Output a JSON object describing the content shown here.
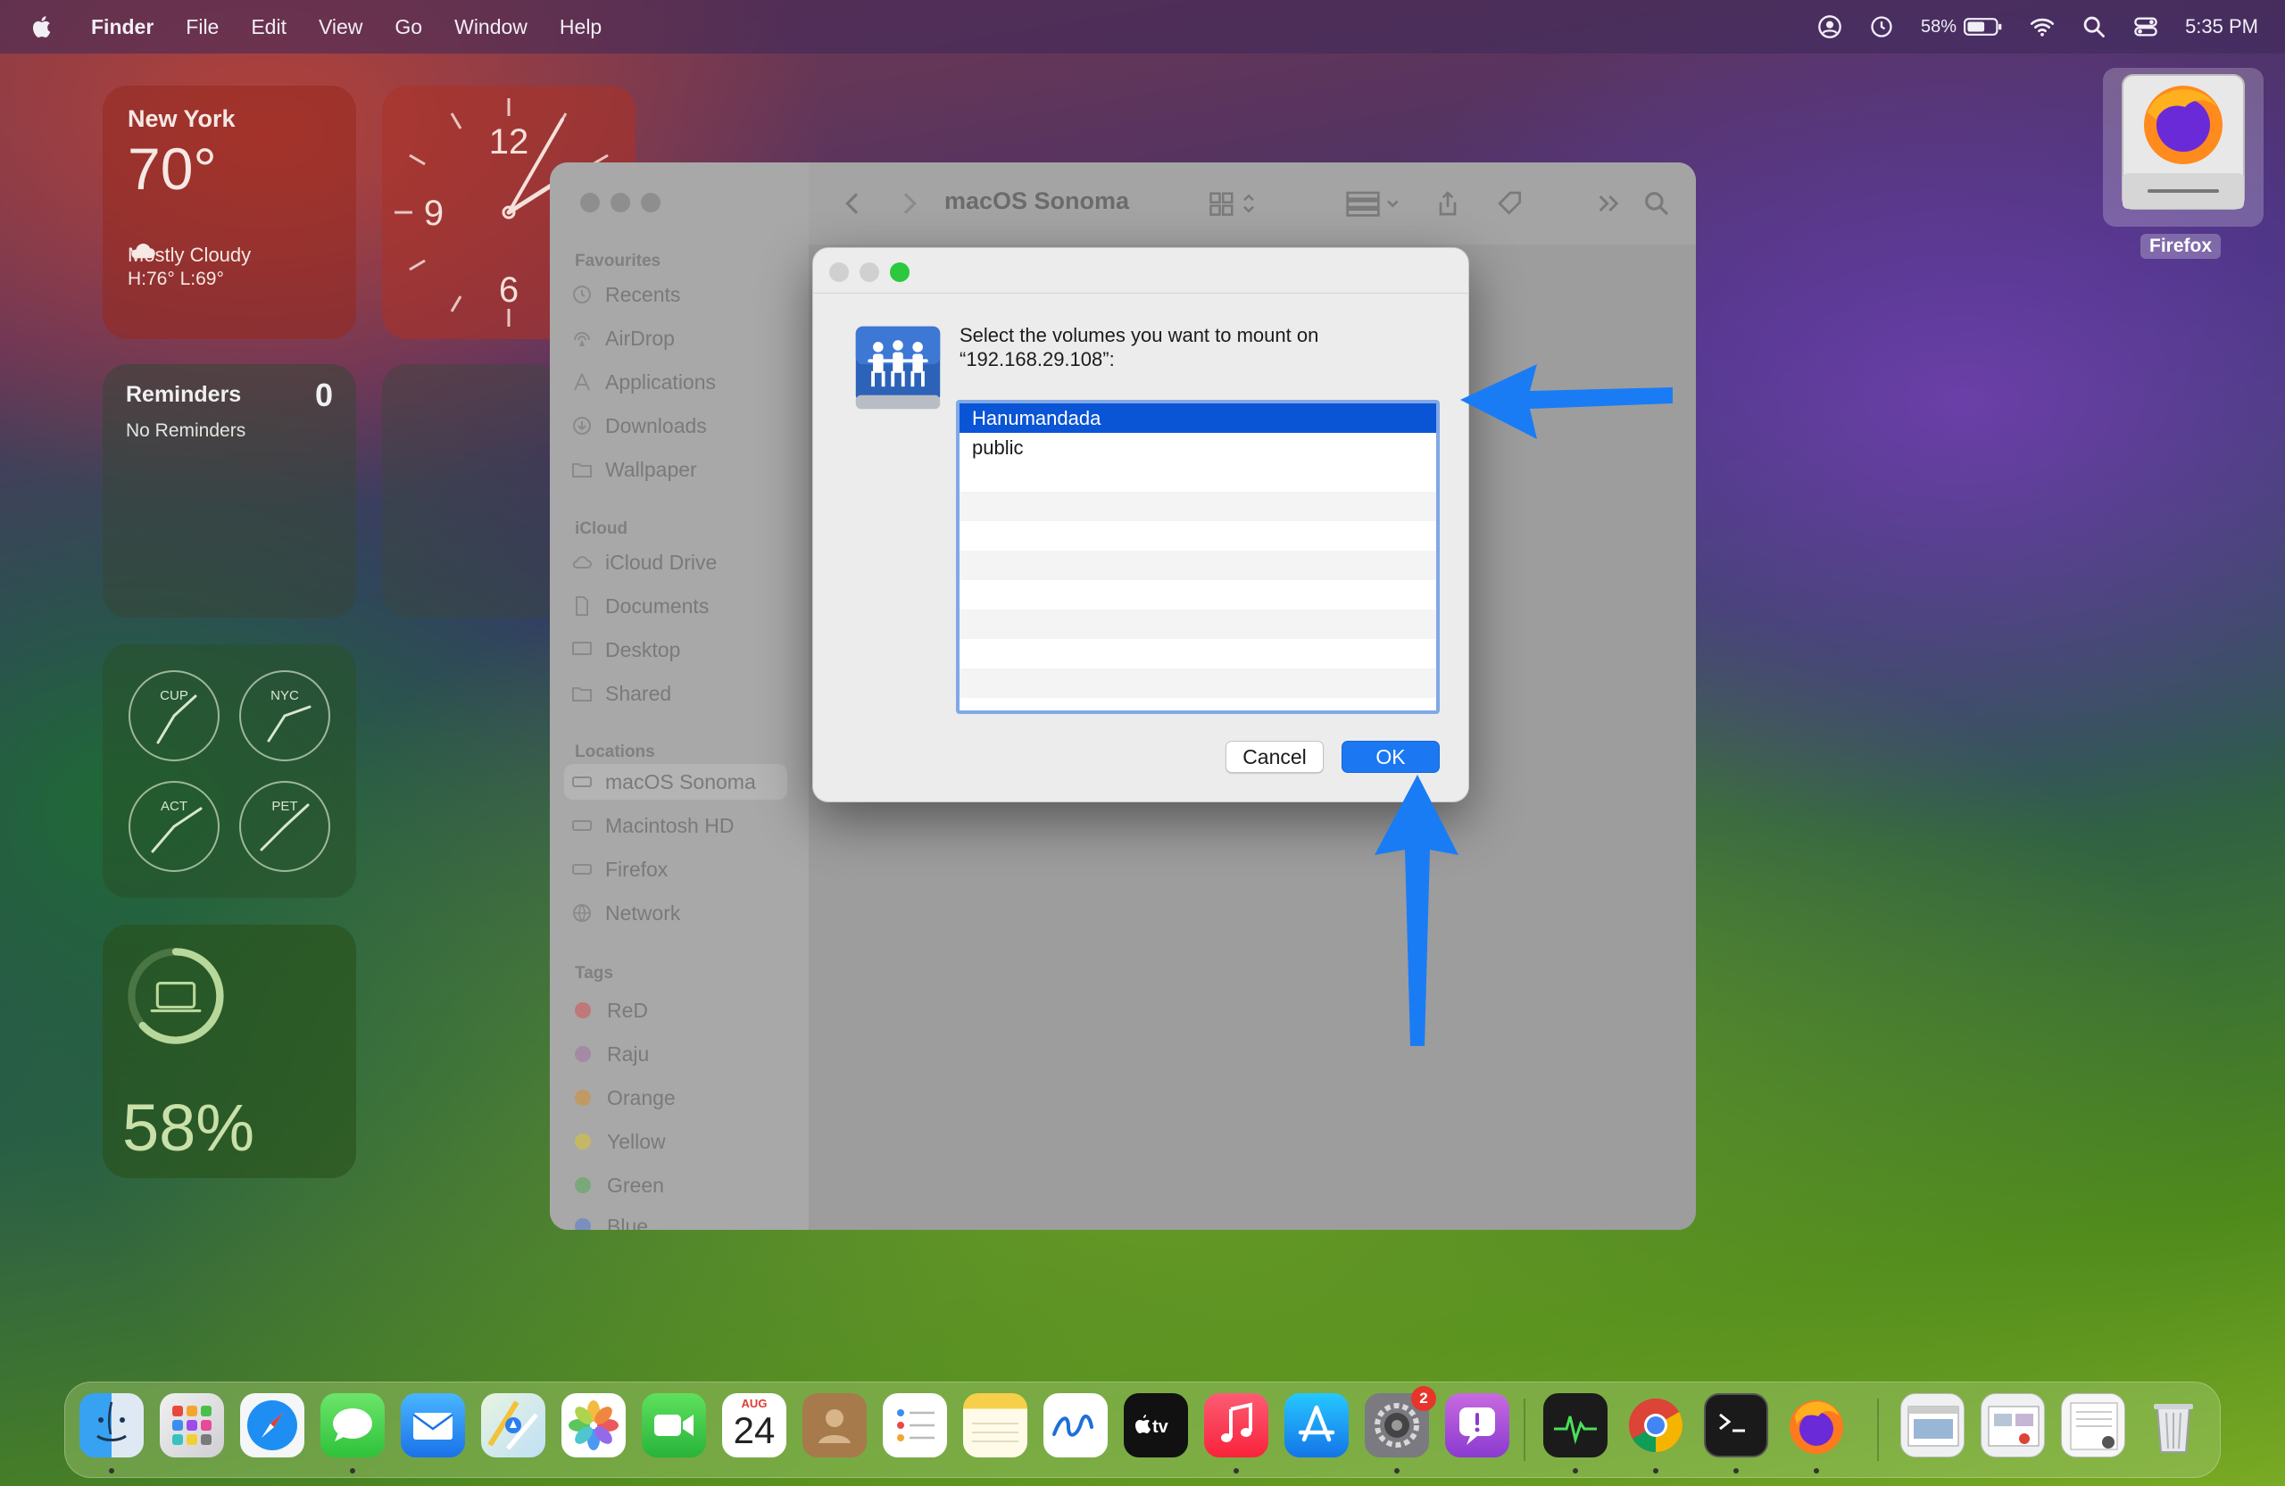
{
  "menubar": {
    "app_name": "Finder",
    "menus": [
      "File",
      "Edit",
      "View",
      "Go",
      "Window",
      "Help"
    ],
    "battery_percent": "58%",
    "time": "5:35 PM"
  },
  "widgets": {
    "weather": {
      "city": "New York",
      "temp": "70°",
      "condition": "Mostly Cloudy",
      "high_low": "H:76° L:69°"
    },
    "clock": {
      "numerals": [
        "12",
        "9",
        "6"
      ]
    },
    "reminders": {
      "title": "Reminders",
      "count": "0",
      "subtitle": "No Reminders"
    },
    "world_clocks": [
      "CUP",
      "NYC",
      "ACT",
      "PET"
    ],
    "battery": {
      "percent": "58%"
    }
  },
  "desktop": {
    "icon_label": "Firefox"
  },
  "finder": {
    "title": "macOS Sonoma",
    "sidebar": {
      "favourites_label": "Favourites",
      "favourites": [
        "Recents",
        "AirDrop",
        "Applications",
        "Downloads",
        "Wallpaper"
      ],
      "icloud_label": "iCloud",
      "icloud": [
        "iCloud Drive",
        "Documents",
        "Desktop",
        "Shared"
      ],
      "locations_label": "Locations",
      "locations": [
        "macOS Sonoma",
        "Macintosh HD",
        "Firefox",
        "Network"
      ],
      "tags_label": "Tags",
      "tags": [
        "ReD",
        "Raju",
        "Orange",
        "Yellow",
        "Green",
        "Blue"
      ]
    }
  },
  "dialog": {
    "message": "Select the volumes you want to mount on “192.168.29.108”:",
    "volumes": [
      "Hanumandada",
      "public"
    ],
    "selected_volume": "Hanumandada",
    "cancel_label": "Cancel",
    "ok_label": "OK"
  },
  "dock": {
    "calendar_month": "AUG",
    "calendar_day": "24",
    "settings_badge": "2",
    "tv_label": "tv"
  },
  "colors": {
    "accent": "#1c78f2",
    "selection": "#0a54d6",
    "arrow": "#1a7cf5"
  }
}
